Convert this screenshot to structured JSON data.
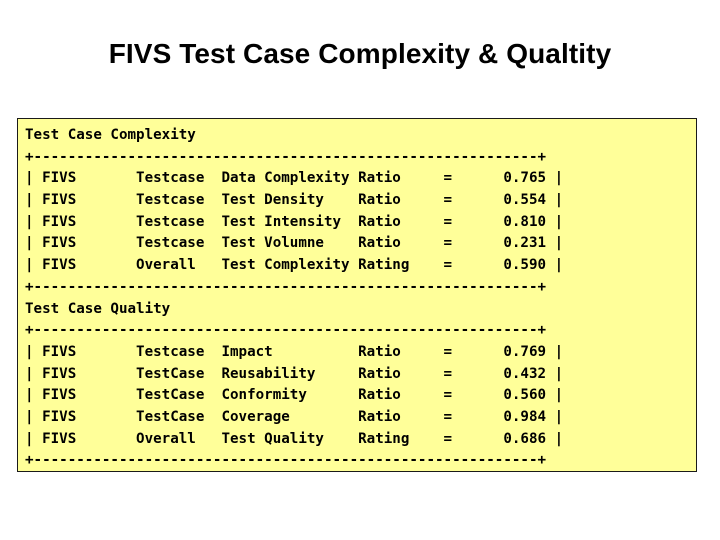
{
  "slide": {
    "title": "FIVS Test Case Complexity & Qualtity",
    "background_color": "#ffffff",
    "panel_fill_color": "#ffff99",
    "panel_border_color": "#1a1a1a",
    "text_color": "#000000"
  },
  "report": {
    "sections": [
      {
        "heading": "Test Case Complexity",
        "top_border": "+-----------------------------------------------------------+",
        "bottom_border": "+-----------------------------------------------------------+",
        "rows": [
          {
            "system": "FIVS",
            "scope": "Testcase",
            "metric": "Data Complexity",
            "kind": "Ratio",
            "operator": "=",
            "value": "0.765"
          },
          {
            "system": "FIVS",
            "scope": "Testcase",
            "metric": "Test Density",
            "kind": "Ratio",
            "operator": "=",
            "value": "0.554"
          },
          {
            "system": "FIVS",
            "scope": "Testcase",
            "metric": "Test Intensity",
            "kind": "Ratio",
            "operator": "=",
            "value": "0.810"
          },
          {
            "system": "FIVS",
            "scope": "Testcase",
            "metric": "Test Volumne",
            "kind": "Ratio",
            "operator": "=",
            "value": "0.231"
          },
          {
            "system": "FIVS",
            "scope": "Overall",
            "metric": "Test Complexity",
            "kind": "Rating",
            "operator": "=",
            "value": "0.590"
          }
        ]
      },
      {
        "heading": "Test Case Quality",
        "top_border": "+-----------------------------------------------------------+",
        "bottom_border": "+-----------------------------------------------------------+",
        "rows": [
          {
            "system": "FIVS",
            "scope": "Testcase",
            "metric": "Impact",
            "kind": "Ratio",
            "operator": "=",
            "value": "0.769"
          },
          {
            "system": "FIVS",
            "scope": "TestCase",
            "metric": "Reusability",
            "kind": "Ratio",
            "operator": "=",
            "value": "0.432"
          },
          {
            "system": "FIVS",
            "scope": "TestCase",
            "metric": "Conformity",
            "kind": "Ratio",
            "operator": "=",
            "value": "0.560"
          },
          {
            "system": "FIVS",
            "scope": "TestCase",
            "metric": "Coverage",
            "kind": "Ratio",
            "operator": "=",
            "value": "0.984"
          },
          {
            "system": "FIVS",
            "scope": "Overall",
            "metric": "Test Quality",
            "kind": "Rating",
            "operator": "=",
            "value": "0.686"
          }
        ]
      }
    ],
    "lines": [
      "Test Case Complexity",
      "+-----------------------------------------------------------+",
      "| FIVS       Testcase  Data Complexity Ratio     =      0.765 |",
      "| FIVS       Testcase  Test Density    Ratio     =      0.554 |",
      "| FIVS       Testcase  Test Intensity  Ratio     =      0.810 |",
      "| FIVS       Testcase  Test Volumne    Ratio     =      0.231 |",
      "| FIVS       Overall   Test Complexity Rating    =      0.590 |",
      "+-----------------------------------------------------------+",
      "Test Case Quality",
      "+-----------------------------------------------------------+",
      "| FIVS       Testcase  Impact          Ratio     =      0.769 |",
      "| FIVS       TestCase  Reusability     Ratio     =      0.432 |",
      "| FIVS       TestCase  Conformity      Ratio     =      0.560 |",
      "| FIVS       TestCase  Coverage        Ratio     =      0.984 |",
      "| FIVS       Overall   Test Quality    Rating    =      0.686 |",
      "+-----------------------------------------------------------+"
    ]
  }
}
